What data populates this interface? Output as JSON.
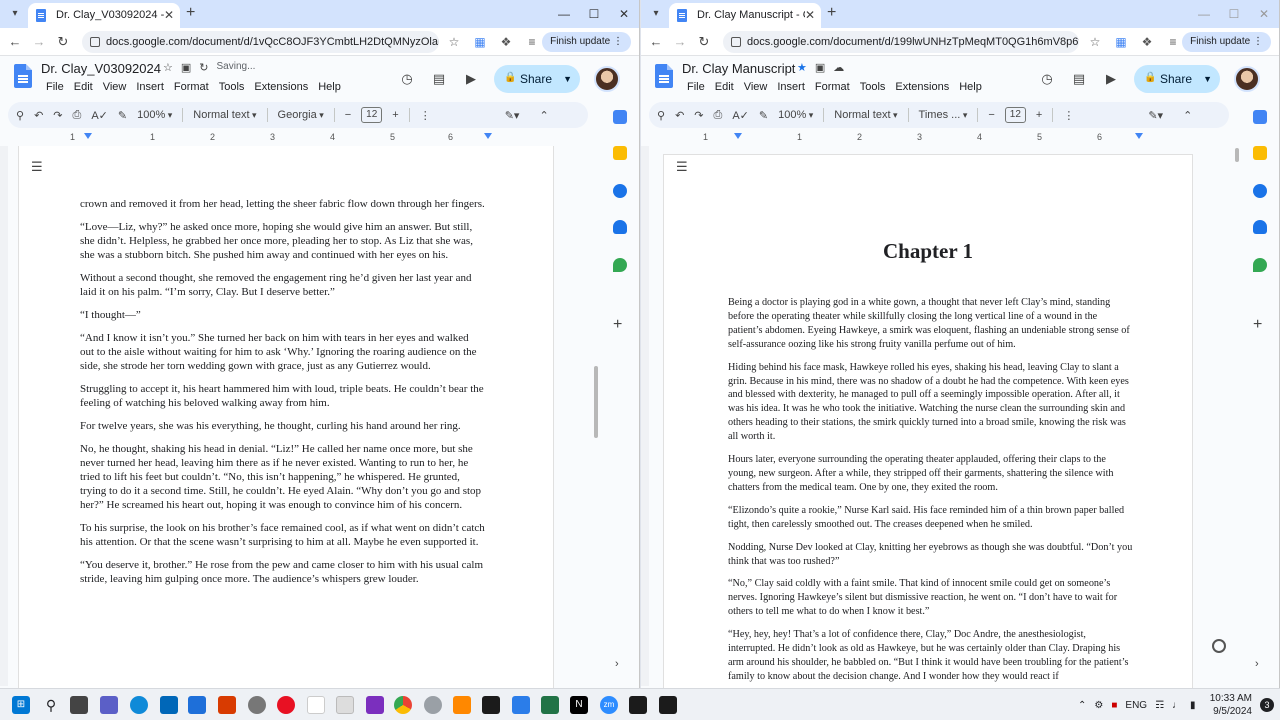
{
  "left": {
    "tab_title": "Dr. Clay_V03092024 - Google D",
    "url": "docs.google.com/document/d/1vQcC8OJF3YCmbtLH2DtQMNyzOlaDBSZ...",
    "finish_update": "Finish update",
    "doc_title": "Dr. Clay_V03092024",
    "saving": "Saving...",
    "menu": [
      "File",
      "Edit",
      "View",
      "Insert",
      "Format",
      "Tools",
      "Extensions",
      "Help"
    ],
    "share": "Share",
    "toolbar": {
      "zoom": "100%",
      "style": "Normal text",
      "font": "Georgia",
      "size": "12"
    },
    "ruler": [
      "1",
      "1",
      "2",
      "3",
      "4",
      "5",
      "6"
    ],
    "paragraphs": [
      "crown and removed it from her head, letting the sheer fabric flow down through her fingers.",
      "“Love—Liz, why?” he asked once more, hoping she would give him an answer. But still, she didn’t. Helpless, he grabbed her once more, pleading her to stop. As Liz that she was, she was a stubborn bitch. She pushed him away and continued with her eyes on his.",
      "Without a second thought, she removed the engagement ring he’d given her last year and laid it on his palm. “I’m sorry, Clay. But I deserve better.”",
      "“I thought—”",
      "“And I know it isn’t you.” She turned her back on him with tears in her eyes and walked out to the aisle without waiting for him to ask ‘Why.’ Ignoring the roaring audience on the side, she strode her torn wedding gown with grace, just as any Gutierrez would.",
      "Struggling to accept it, his heart hammered him with loud, triple beats. He couldn’t bear the feeling of watching his beloved walking away from him.",
      "For twelve years, she was his everything, he thought, curling his hand around her ring.",
      "No, he thought, shaking his head in denial. “Liz!” He called her name once more, but she never turned her head, leaving him there as if he never existed. Wanting to run to her, he tried to lift his feet but couldn’t. “No, this isn’t happening,” he whispered. He grunted, trying to do it a second time. Still, he couldn’t. He eyed Alain. “Why don’t you go and stop her?” He screamed his heart out, hoping it was enough to convince him of his concern.",
      "To his surprise, the look on his brother’s face remained cool, as if what went on didn’t catch his attention. Or that the scene wasn’t surprising to him at all. Maybe he even supported it.",
      "“You deserve it, brother.” He rose from the pew and came closer to him with his usual calm stride, leaving him gulping once more. The audience’s whispers grew louder."
    ]
  },
  "right": {
    "tab_title": "Dr. Clay Manuscript - Google D",
    "url": "docs.google.com/document/d/199lwUNHzTpMeqMT0QG1h6mV8p6tqgS...",
    "finish_update": "Finish update",
    "doc_title": "Dr. Clay Manuscript",
    "menu": [
      "File",
      "Edit",
      "View",
      "Insert",
      "Format",
      "Tools",
      "Extensions",
      "Help"
    ],
    "share": "Share",
    "toolbar": {
      "zoom": "100%",
      "style": "Normal text",
      "font": "Times ...",
      "size": "12"
    },
    "ruler": [
      "1",
      "1",
      "2",
      "3",
      "4",
      "5",
      "6"
    ],
    "chapter": "Chapter 1",
    "paragraphs": [
      "Being a doctor is playing god in a white gown, a thought that never left Clay’s mind, standing before the operating theater while skillfully closing the long vertical line of a wound in the patient’s abdomen. Eyeing Hawkeye, a smirk was eloquent, flashing an undeniable strong sense of self-assurance oozing like his strong fruity vanilla perfume out of him.",
      "Hiding behind his face mask, Hawkeye rolled his eyes, shaking his head, leaving Clay to slant a grin. Because in his mind, there was no shadow of a doubt he had the competence. With keen eyes and blessed with dexterity, he managed to pull off a seemingly impossible operation. After all, it was his idea. It was he who took the initiative. Watching the nurse clean the surrounding skin and others heading to their stations, the smirk quickly turned into a broad smile, knowing the risk was all worth it.",
      "Hours later, everyone surrounding the operating theater applauded, offering their claps to the young, new surgeon. After a while, they stripped off their garments, shattering the silence with chatters from the medical team. One by one, they exited the room.",
      "“Elizondo’s quite a rookie,” Nurse Karl said. His face reminded him of a thin brown paper balled tight, then carelessly smoothed out. The creases deepened when he smiled.",
      "Nodding, Nurse Dev looked at Clay, knitting her eyebrows as though she was doubtful. “Don’t you think that was too rushed?”",
      "“No,” Clay said coldly with a faint smile. That kind of innocent smile could get on someone’s nerves. Ignoring Hawkeye’s silent but dismissive reaction, he went on. “I don’t have to wait for others to tell me what to do when I know it best.”",
      "“Hey, hey, hey! That’s a lot of confidence there, Clay,” Doc Andre, the anesthesiologist, interrupted. He didn’t look as old as Hawkeye, but he was certainly older than Clay. Draping his arm around his shoulder, he babbled on. “But I think it would have been troubling for the patient’s family to know about the decision change. And I wonder how they would react if"
    ]
  },
  "taskbar": {
    "lang": "ENG",
    "time": "10:33 AM",
    "date": "9/5/2024",
    "notifications": "3"
  },
  "colors": {
    "accent": "#4285f4",
    "share": "#c2e7ff",
    "tabstrip": "#d3e3fd"
  }
}
